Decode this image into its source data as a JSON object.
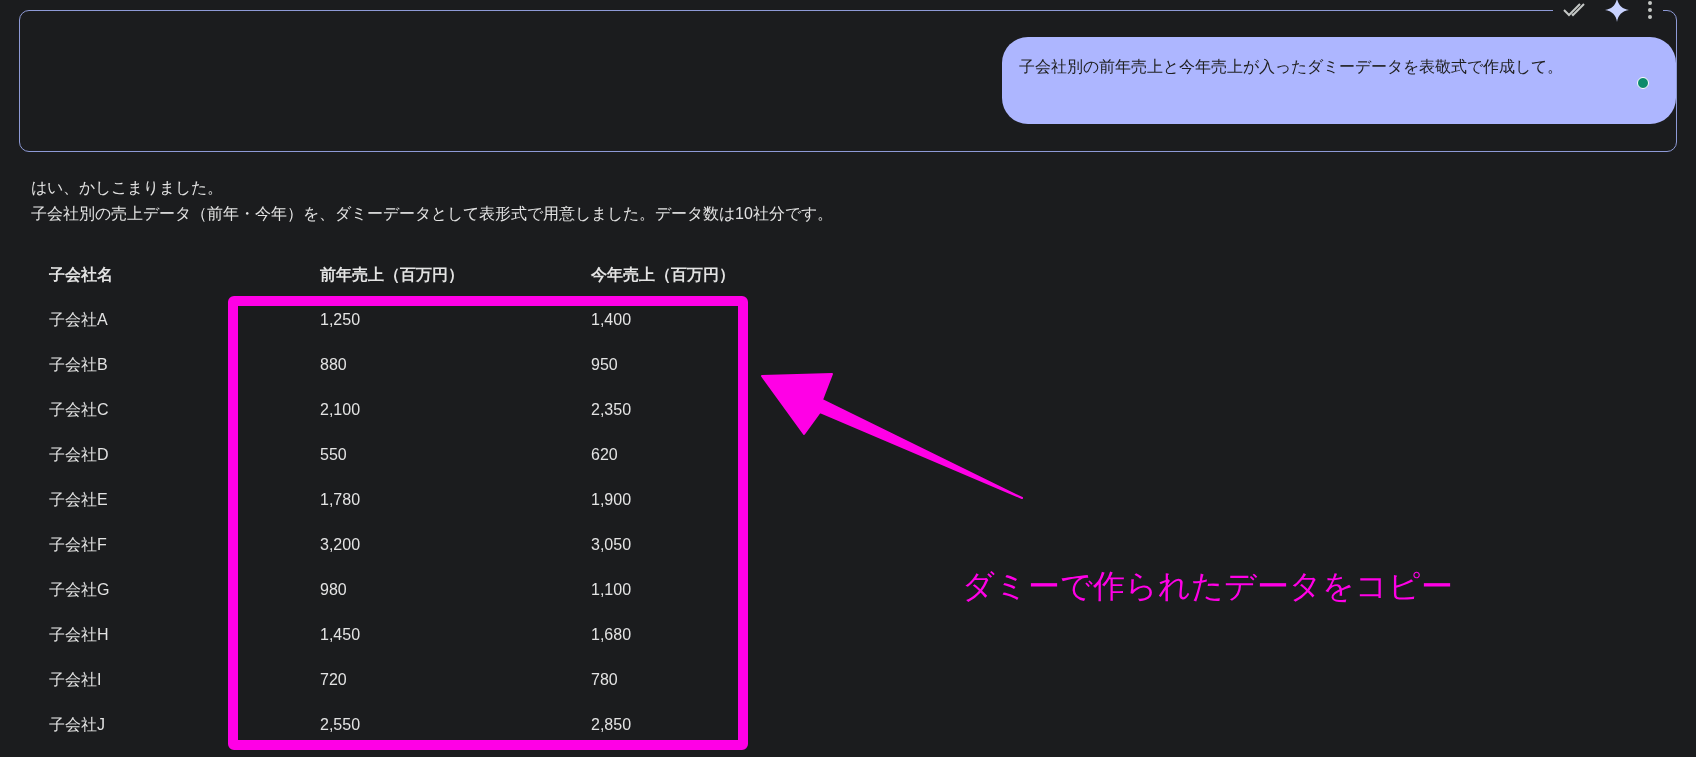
{
  "prompt_bubble": {
    "text": "子会社別の前年売上と今年売上が入ったダミーデータを表敬式で作成して。"
  },
  "response": {
    "lines": [
      "はい、かしこまりました。",
      "子会社別の売上データ（前年・今年）を、ダミーデータとして表形式で用意しました。データ数は10社分です。"
    ]
  },
  "table": {
    "columns": [
      "子会社名",
      "前年売上（百万円）",
      "今年売上（百万円）"
    ],
    "rows": [
      [
        "子会社A",
        "1,250",
        "1,400"
      ],
      [
        "子会社B",
        "880",
        "950"
      ],
      [
        "子会社C",
        "2,100",
        "2,350"
      ],
      [
        "子会社D",
        "550",
        "620"
      ],
      [
        "子会社E",
        "1,780",
        "1,900"
      ],
      [
        "子会社F",
        "3,200",
        "3,050"
      ],
      [
        "子会社G",
        "980",
        "1,100"
      ],
      [
        "子会社H",
        "1,450",
        "1,680"
      ],
      [
        "子会社I",
        "720",
        "780"
      ],
      [
        "子会社J",
        "2,550",
        "2,850"
      ]
    ]
  },
  "annotation": {
    "text": "ダミーで作られたデータをコピー"
  }
}
